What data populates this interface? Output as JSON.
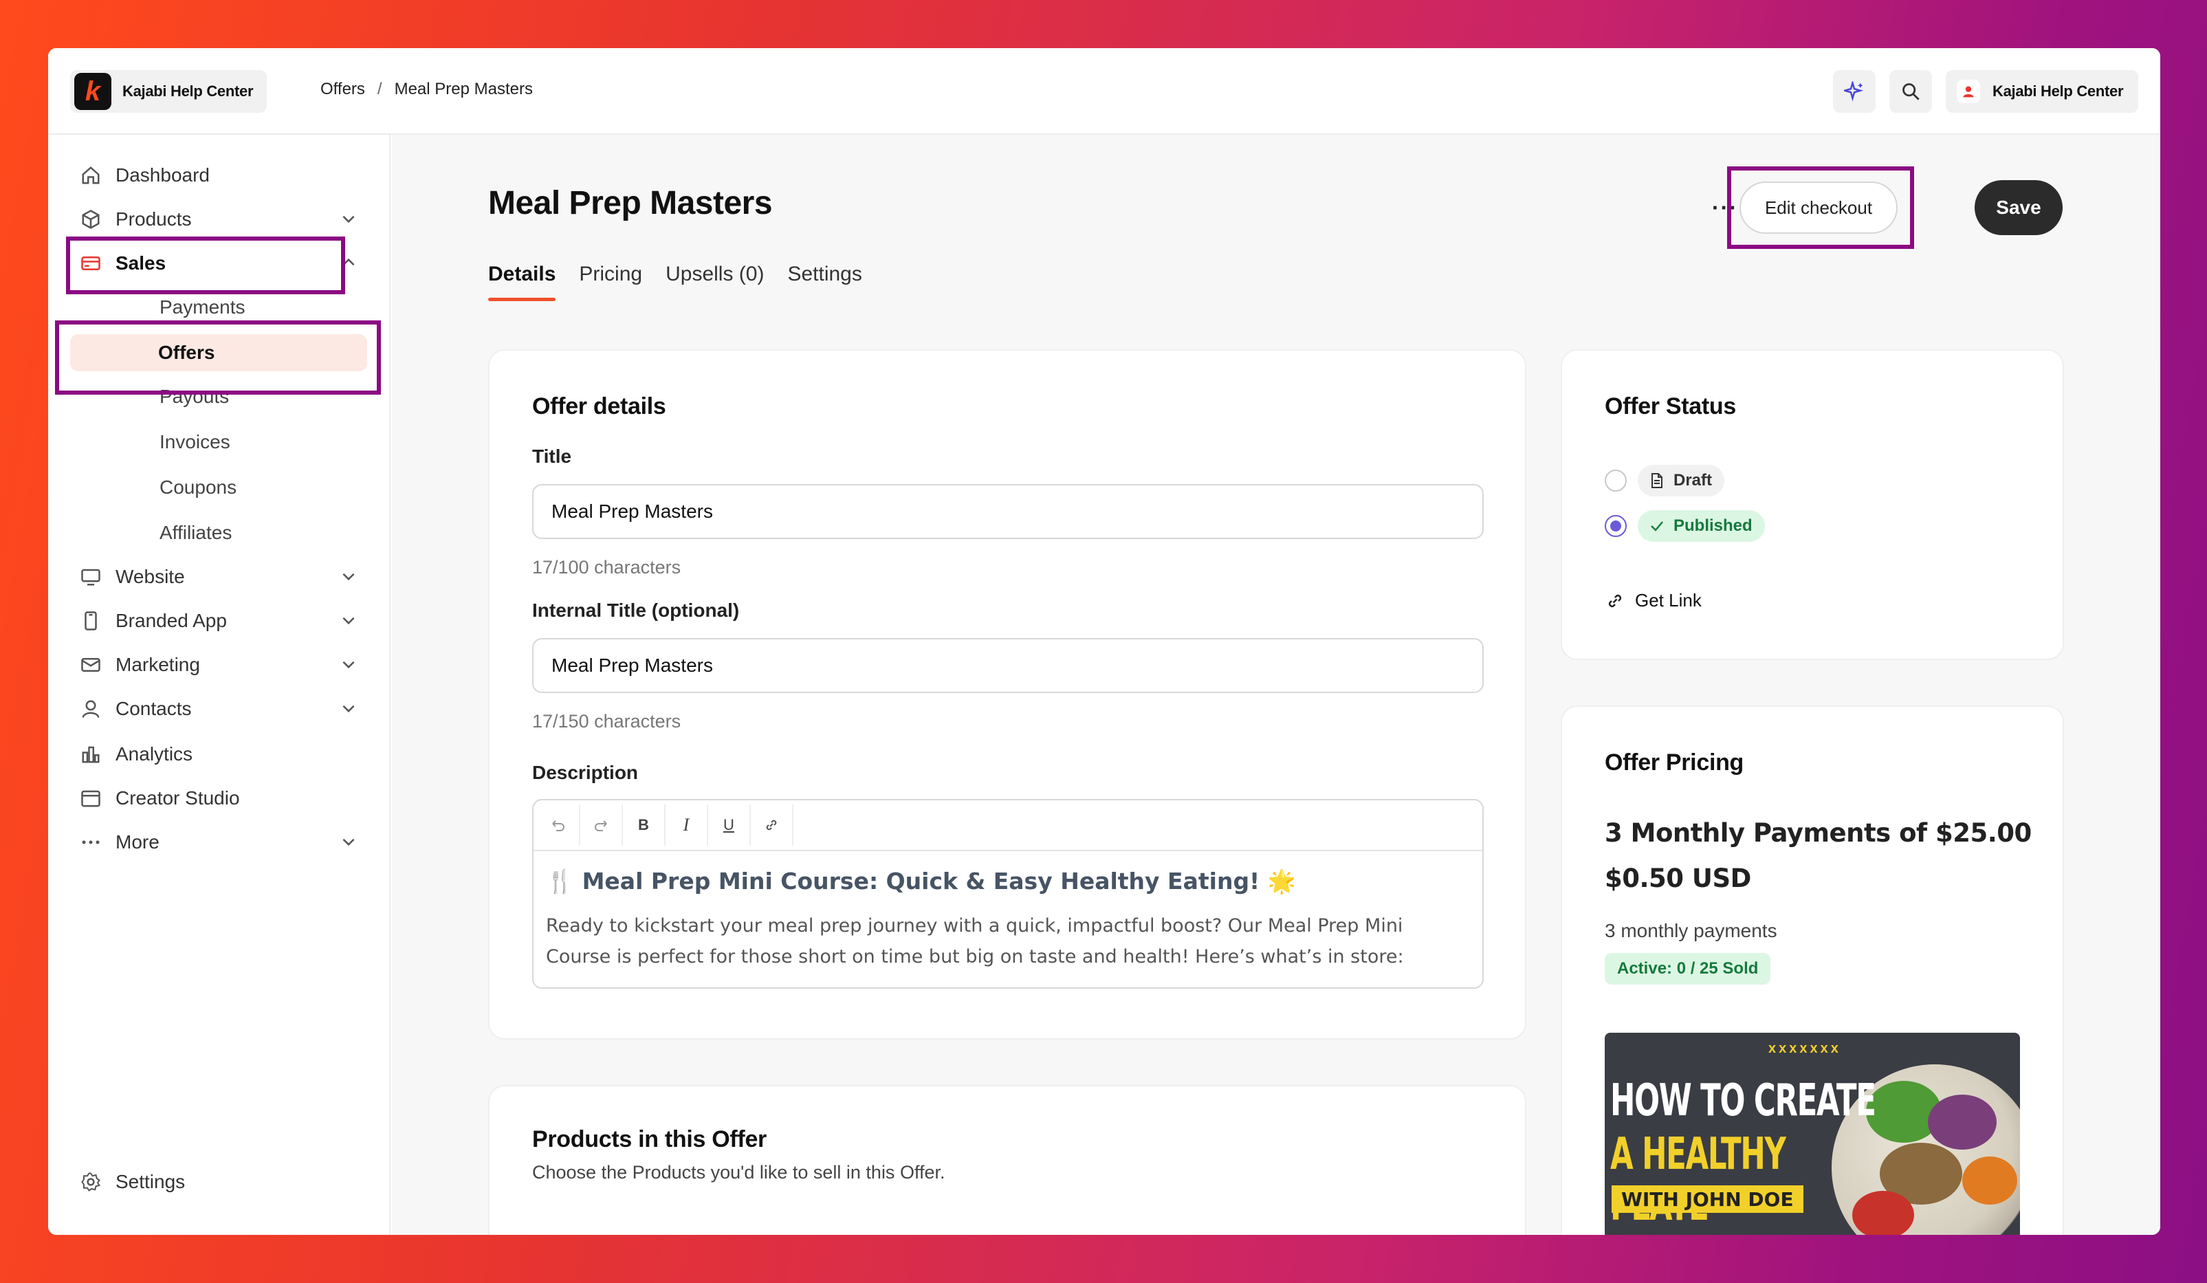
{
  "brand": {
    "name": "Kajabi Help Center",
    "logo_letter": "k"
  },
  "breadcrumb": {
    "parent": "Offers",
    "separator": "/",
    "current": "Meal Prep Masters"
  },
  "account": {
    "name": "Kajabi Help Center"
  },
  "sidebar": {
    "items": [
      {
        "label": "Dashboard",
        "icon": "home-icon"
      },
      {
        "label": "Products",
        "icon": "box-icon"
      },
      {
        "label": "Sales",
        "icon": "credit-card-icon"
      },
      {
        "label": "Website",
        "icon": "monitor-icon"
      },
      {
        "label": "Branded App",
        "icon": "phone-icon"
      },
      {
        "label": "Marketing",
        "icon": "mail-icon"
      },
      {
        "label": "Contacts",
        "icon": "contacts-icon"
      },
      {
        "label": "Analytics",
        "icon": "analytics-icon"
      },
      {
        "label": "Creator Studio",
        "icon": "calendar-icon"
      },
      {
        "label": "More",
        "icon": "more-icon"
      }
    ],
    "sales_subitems": [
      "Payments",
      "Offers",
      "Payouts",
      "Invoices",
      "Coupons",
      "Affiliates"
    ],
    "settings": "Settings"
  },
  "page": {
    "title": "Meal Prep Masters",
    "more": "···",
    "edit_checkout": "Edit checkout",
    "save": "Save",
    "tabs": [
      "Details",
      "Pricing",
      "Upsells (0)",
      "Settings"
    ]
  },
  "offer_details": {
    "title": "Offer details",
    "title_label": "Title",
    "title_value": "Meal Prep Masters",
    "title_count": "17/100 characters",
    "internal_label": "Internal Title (optional)",
    "internal_value": "Meal Prep Masters",
    "internal_count": "17/150 characters",
    "description_label": "Description",
    "description_heading": "🍴 Meal Prep Mini Course: Quick & Easy Healthy Eating! 🌟",
    "description_body": "Ready to kickstart your meal prep journey with a quick, impactful boost? Our Meal Prep Mini Course is perfect for those short on time but big on taste and health! Here’s what’s in store:",
    "toolbar": {
      "bold": "B",
      "italic": "I",
      "underline": "U"
    }
  },
  "products": {
    "title": "Products in this Offer",
    "subtitle": "Choose the Products you'd like to sell in this Offer."
  },
  "offer_status": {
    "title": "Offer Status",
    "draft": "Draft",
    "published": "Published",
    "selected": "Published",
    "get_link": "Get Link"
  },
  "offer_pricing": {
    "title": "Offer Pricing",
    "price_line1": "3 Monthly Payments of $25.00",
    "price_line2": "$0.50 USD",
    "payments": "3 monthly payments",
    "active_badge": "Active: 0 / 25 Sold",
    "thumbnail": {
      "line1": "HOW TO CREATE",
      "line2": "A HEALTHY PLATE",
      "line3": "WITH JOHN DOE",
      "decor": "xxxxxxx"
    }
  },
  "colors": {
    "accent": "#f0502a",
    "highlight": "#8b0a83",
    "radio": "#6b5bd6",
    "published_bg": "#dcf6e4",
    "published_text": "#157a3c"
  }
}
